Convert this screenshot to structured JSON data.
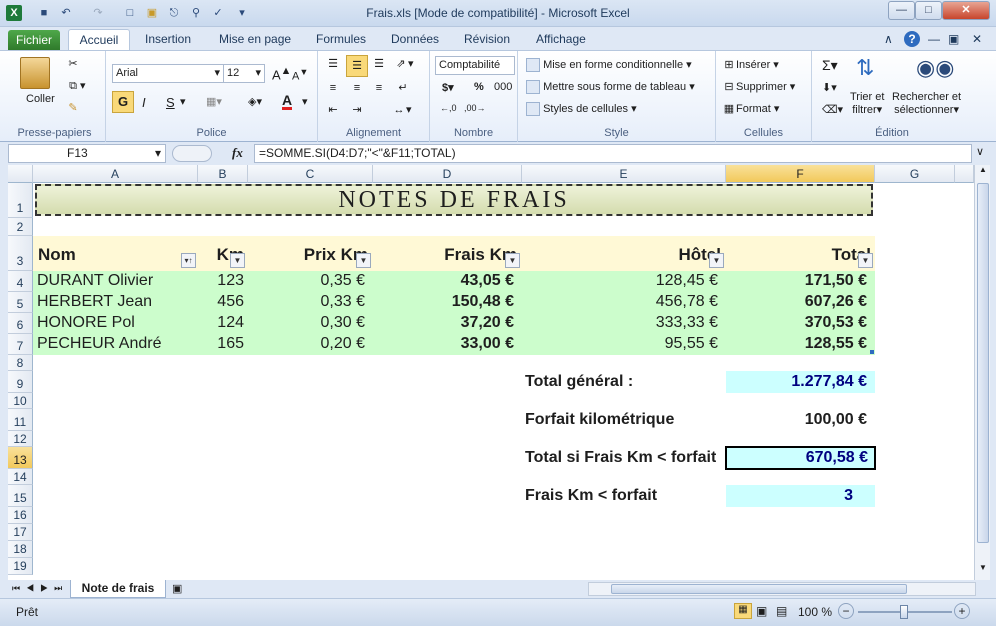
{
  "window": {
    "title": "Frais.xls  [Mode de compatibilité]  -  Microsoft Excel"
  },
  "ribbon_tabs": [
    "Fichier",
    "Accueil",
    "Insertion",
    "Mise en page",
    "Formules",
    "Données",
    "Révision",
    "Affichage"
  ],
  "clipboard": {
    "paste": "Coller",
    "label": "Presse-papiers"
  },
  "font": {
    "name": "Arial",
    "size": "12",
    "bold": "G",
    "italic": "I",
    "underline": "S",
    "color_letter": "A",
    "label": "Police"
  },
  "alignment": {
    "label": "Alignement"
  },
  "number": {
    "format": "Comptabilité",
    "currency": "$",
    "percent": "%",
    "thousands": "000",
    "label": "Nombre"
  },
  "style": {
    "conditional": "Mise en forme conditionnelle",
    "as_table": "Mettre sous forme de tableau",
    "cell_styles": "Styles de cellules",
    "label": "Style"
  },
  "cells_group": {
    "insert": "Insérer",
    "delete": "Supprimer",
    "format": "Format",
    "label": "Cellules"
  },
  "edition": {
    "sort": "Trier et",
    "sort2": "filtrer",
    "find": "Rechercher et",
    "find2": "sélectionner",
    "label": "Édition"
  },
  "formula_bar": {
    "name_box": "F13",
    "fx": "fx",
    "formula": "=SOMME.SI(D4:D7;\"<\"&F11;TOTAL)"
  },
  "columns": [
    "A",
    "B",
    "C",
    "D",
    "E",
    "F",
    "G"
  ],
  "rows": [
    "1",
    "2",
    "3",
    "4",
    "5",
    "6",
    "7",
    "8",
    "9",
    "10",
    "11",
    "12",
    "13",
    "14",
    "15",
    "16",
    "17",
    "18",
    "19"
  ],
  "sheet": {
    "title": "NOTES DE FRAIS",
    "headers": {
      "nom": "Nom",
      "km": "Km",
      "prix": "Prix Km",
      "frais": "Frais Km",
      "hotel": "Hôtel",
      "total": "Total"
    },
    "data": [
      {
        "nom": "DURANT Olivier",
        "km": "123",
        "prix": "0,35 €",
        "frais": "43,05 €",
        "hotel": "128,45 €",
        "total": "171,50 €"
      },
      {
        "nom": "HERBERT Jean",
        "km": "456",
        "prix": "0,33 €",
        "frais": "150,48 €",
        "hotel": "456,78 €",
        "total": "607,26 €"
      },
      {
        "nom": "HONORE Pol",
        "km": "124",
        "prix": "0,30 €",
        "frais": "37,20 €",
        "hotel": "333,33 €",
        "total": "370,53 €"
      },
      {
        "nom": "PECHEUR André",
        "km": "165",
        "prix": "0,20 €",
        "frais": "33,00 €",
        "hotel": "95,55 €",
        "total": "128,55 €"
      }
    ],
    "summary": [
      {
        "label": "Total général :",
        "value": "1.277,84 €"
      },
      {
        "label": "Forfait kilométrique",
        "value": "100,00 €"
      },
      {
        "label": "Total si Frais Km < forfait",
        "value": "670,58 €"
      },
      {
        "label": "Frais Km < forfait",
        "value": "3"
      }
    ]
  },
  "sheet_tab": "Note de frais",
  "status": {
    "ready": "Prêt",
    "zoom": "100 %"
  }
}
